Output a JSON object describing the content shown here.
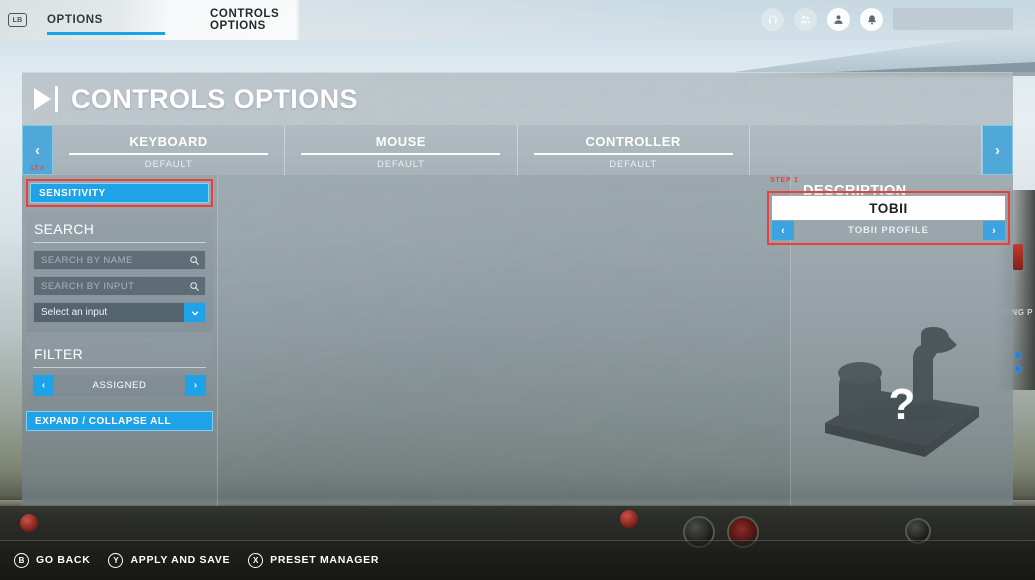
{
  "topbar": {
    "lb_key": "LB",
    "tabs": [
      {
        "label": "OPTIONS",
        "active": true
      },
      {
        "label": "CONTROLS OPTIONS",
        "active": false
      }
    ],
    "icons": [
      {
        "name": "headset-icon",
        "glyph": "☎"
      },
      {
        "name": "friends-icon",
        "glyph": "👥"
      },
      {
        "name": "profile-icon",
        "glyph": "👤"
      },
      {
        "name": "notifications-icon",
        "glyph": "🔔"
      }
    ]
  },
  "panel": {
    "title": "CONTROLS OPTIONS",
    "prev_arrow": "‹",
    "next_arrow": "›",
    "prev_key_hint": "LT 2",
    "step_label": "STEP 1",
    "devices": [
      {
        "name": "KEYBOARD",
        "profile": "DEFAULT"
      },
      {
        "name": "MOUSE",
        "profile": "DEFAULT"
      },
      {
        "name": "CONTROLLER",
        "profile": "DEFAULT"
      }
    ],
    "selected_device": {
      "name": "TOBII",
      "profile": "TOBII PROFILE",
      "prev": "‹",
      "next": "›"
    }
  },
  "sidebar": {
    "sensitivity_label": "SENSITIVITY",
    "search": {
      "heading": "SEARCH",
      "by_name_placeholder": "SEARCH BY NAME",
      "by_name_value": "",
      "by_input_placeholder": "SEARCH BY INPUT",
      "by_input_value": "",
      "select_input_value": "Select an input",
      "chevron": "❯"
    },
    "filter": {
      "heading": "FILTER",
      "value": "ASSIGNED",
      "prev": "‹",
      "next": "›"
    },
    "expand_collapse_label": "EXPAND / COLLAPSE ALL"
  },
  "description": {
    "heading": "DESCRIPTION",
    "placeholder_glyph": "?"
  },
  "bottombar": {
    "actions": [
      {
        "key": "B",
        "label": "GO BACK"
      },
      {
        "key": "Y",
        "label": "APPLY AND SAVE"
      },
      {
        "key": "X",
        "label": "PRESET MANAGER"
      }
    ]
  },
  "background": {
    "side_text": "SING P"
  },
  "colors": {
    "accent_blue": "#1ea2e8",
    "highlight_red": "#e8413c",
    "tab_underline": "#16a5e4"
  }
}
